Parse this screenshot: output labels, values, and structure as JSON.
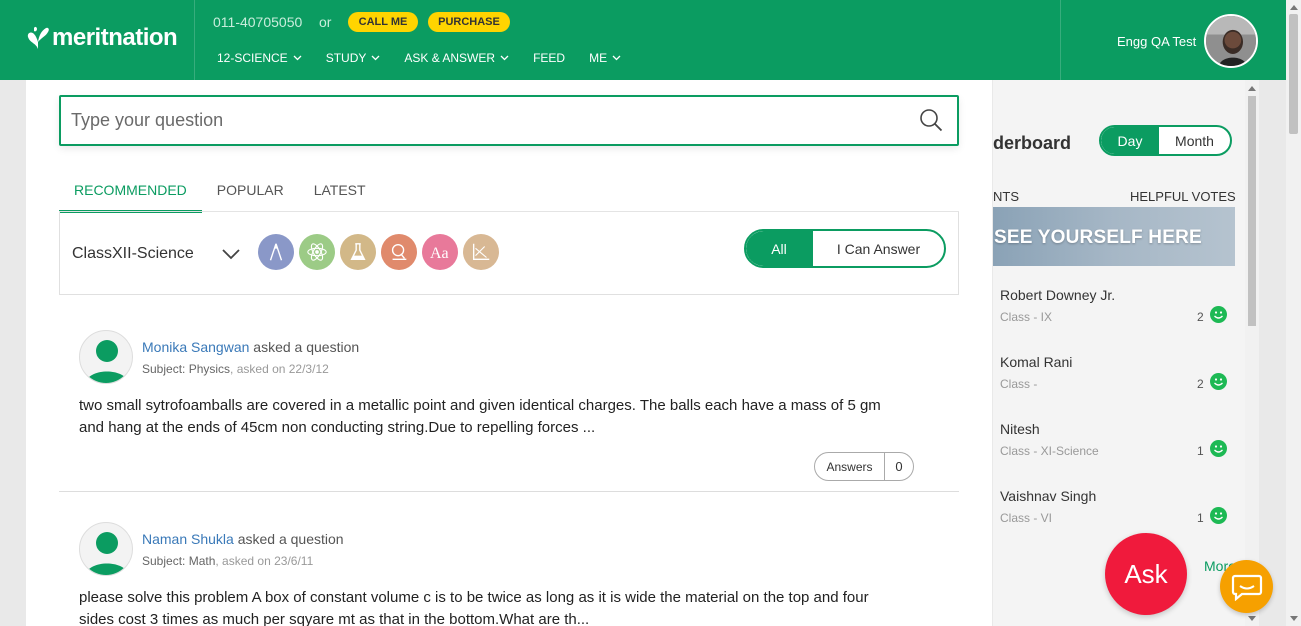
{
  "header": {
    "logo_text": "meritnation",
    "phone": "011-40705050",
    "or_text": "or",
    "call_label": "CALL ME",
    "purchase_label": "PURCHASE",
    "nav": [
      "12-SCIENCE",
      "STUDY",
      "ASK & ANSWER",
      "FEED",
      "ME"
    ],
    "user_name": "Engg QA Test"
  },
  "search": {
    "placeholder": "Type your question"
  },
  "tabs": [
    "RECOMMENDED",
    "POPULAR",
    "LATEST"
  ],
  "filter": {
    "class_value": "ClassXII-Science",
    "subject_icons": [
      {
        "name": "math-compass-icon",
        "color": "#8a98c8"
      },
      {
        "name": "physics-atom-icon",
        "color": "#9ccb86"
      },
      {
        "name": "chemistry-flask-icon",
        "color": "#d2b888"
      },
      {
        "name": "biology-microscope-icon",
        "color": "#e08a6c"
      },
      {
        "name": "english-text-icon",
        "color": "#e8799a"
      },
      {
        "name": "economics-graph-icon",
        "color": "#d8b894"
      }
    ],
    "toggle_all": "All",
    "toggle_can_answer": "I Can Answer"
  },
  "questions": [
    {
      "user": "Monika Sangwan",
      "action": " asked a question",
      "subject_prefix": "Subject: ",
      "subject": "Physics",
      "asked_on": ", asked on 22/3/12",
      "text": "two small sytrofoamballs are covered in a metallic point and given identical charges. The balls each have a mass of 5 gm and hang at the ends of 45cm non conducting string.Due to repelling forces ...",
      "answers_label": "Answers",
      "answers_count": "0"
    },
    {
      "user": "Naman Shukla",
      "action": " asked a question",
      "subject_prefix": "Subject: ",
      "subject": "Math",
      "asked_on": ", asked on 23/6/11",
      "text": "please solve this problem A box of constant volume c is to be twice as long as it is wide the material on the top and four sides cost 3 times as much per sqyare mt as that in the bottom.What are th..."
    }
  ],
  "leaderboard": {
    "title": "derboard",
    "day_label": "Day",
    "month_label": "Month",
    "col_left": "NTS",
    "col_right": "HELPFUL VOTES",
    "banner": "SEE YOURSELF HERE",
    "entries": [
      {
        "name": "Robert Downey Jr.",
        "class": "Class - IX",
        "votes": "2"
      },
      {
        "name": "Komal Rani",
        "class": "Class -",
        "votes": "2"
      },
      {
        "name": "Nitesh",
        "class": "Class - XI-Science",
        "votes": "1"
      },
      {
        "name": "Vaishnav Singh",
        "class": "Class - VI",
        "votes": "1"
      }
    ],
    "more": "More"
  },
  "ask_label": "Ask",
  "colors": {
    "brand_green": "#0b9c61",
    "ask_red": "#f01a3c",
    "yellow": "#ffd400",
    "chat_orange": "#f6a000"
  }
}
